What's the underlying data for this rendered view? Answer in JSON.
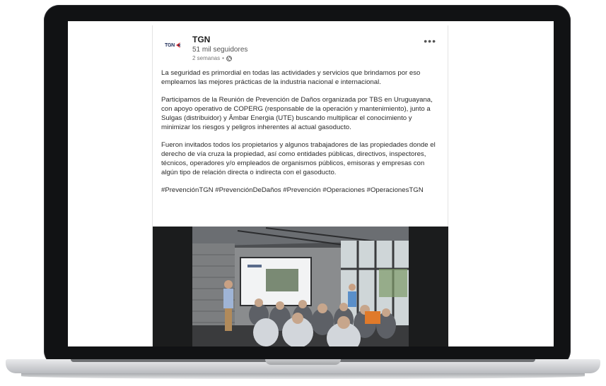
{
  "post": {
    "company": "TGN",
    "logo_text": "TGN",
    "followers": "51 mil seguidores",
    "time": "2 semanas",
    "more": "•••",
    "paragraphs": [
      "La seguridad es primordial en todas las actividades y servicios que brindamos por eso empleamos las mejores prácticas de la industria nacional e internacional.",
      "Participamos de la Reunión de Prevención de Daños organizada por TBS en Uruguayana, con apoyo operativo de COPERG (responsable de la operación y mantenimiento), junto a Sulgas (distribuidor) y Âmbar Energia (UTE) buscando multiplicar el conocimiento y minimizar los riesgos y peligros inherentes al actual gasoducto.",
      "Fueron invitados todos los propietarios y algunos trabajadores de las propiedades donde el derecho de vía cruza la propiedad, así como entidades públicas, directivos, inspectores, técnicos, operadores y/o empleados de organismos públicos, emisoras y empresas con algún tipo de relación directa o indirecta con el gasoducto.",
      "#PrevenciónTGN #PrevenciónDeDaños #Prevención #Operaciones #OperacionesTGN"
    ]
  },
  "colors": {
    "brand_navy": "#1c2b57",
    "brand_red": "#d8232a",
    "laptop_bezel": "#111214"
  },
  "icons": {
    "globe": "globe-icon",
    "more": "more-dots-icon"
  }
}
